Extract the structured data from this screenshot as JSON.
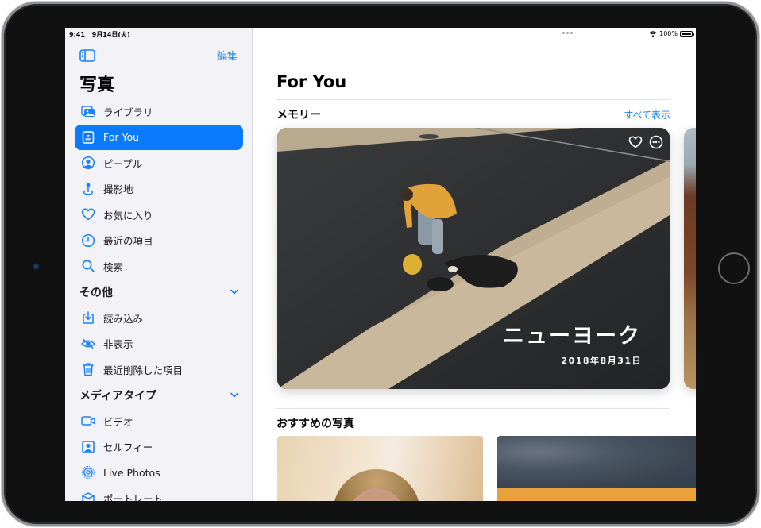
{
  "status_bar": {
    "time": "9:41",
    "date": "9月14日(火)",
    "battery_text": "100%",
    "battery_level": 1.0
  },
  "sidebar": {
    "toggle_icon": "sidebar-icon",
    "edit_label": "編集",
    "title": "写真",
    "items": [
      {
        "label": "ライブラリ",
        "icon": "photo-library-icon",
        "active": false
      },
      {
        "label": "For You",
        "icon": "for-you-icon",
        "active": true
      },
      {
        "label": "ピープル",
        "icon": "person-circle-icon",
        "active": false
      },
      {
        "label": "撮影地",
        "icon": "map-pin-icon",
        "active": false
      },
      {
        "label": "お気に入り",
        "icon": "heart-icon",
        "active": false
      },
      {
        "label": "最近の項目",
        "icon": "clock-icon",
        "active": false
      },
      {
        "label": "検索",
        "icon": "search-icon",
        "active": false
      }
    ],
    "sections": [
      {
        "title": "その他",
        "expanded": true,
        "items": [
          {
            "label": "読み込み",
            "icon": "import-icon"
          },
          {
            "label": "非表示",
            "icon": "eye-slash-icon"
          },
          {
            "label": "最近削除した項目",
            "icon": "trash-icon"
          }
        ]
      },
      {
        "title": "メディアタイプ",
        "expanded": true,
        "items": [
          {
            "label": "ビデオ",
            "icon": "video-icon"
          },
          {
            "label": "セルフィー",
            "icon": "selfie-icon"
          },
          {
            "label": "Live Photos",
            "icon": "live-photos-icon"
          },
          {
            "label": "ポートレート",
            "icon": "portrait-cube-icon"
          }
        ]
      }
    ]
  },
  "main": {
    "title": "For You",
    "memories": {
      "title": "メモリー",
      "see_all_label": "すべて表示",
      "cards": [
        {
          "title": "ニューヨーク",
          "date": "2018年8月31日",
          "actions": [
            "heart-icon",
            "more-icon"
          ]
        }
      ]
    },
    "featured": {
      "title": "おすすめの写真"
    }
  },
  "colors": {
    "accent": "#0a7aff",
    "link": "#1a82fb",
    "sidebar_bg": "#f2f2f7"
  }
}
